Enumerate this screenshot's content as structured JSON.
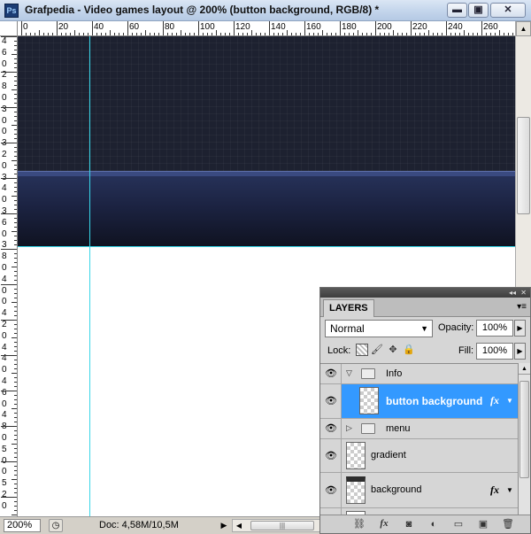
{
  "window": {
    "app_logo": "Ps",
    "title": "Grafpedia - Video games layout @ 200% (button background, RGB/8) *",
    "minimize_glyph": "▬",
    "maximize_glyph": "▣",
    "close_glyph": "✕"
  },
  "rulers": {
    "horizontal": [
      "0",
      "20",
      "40",
      "60",
      "80",
      "100",
      "120",
      "140",
      "160",
      "180",
      "200",
      "220",
      "240",
      "260"
    ],
    "vertical": [
      "4",
      "6",
      "0",
      "2",
      "8",
      "0",
      "3",
      "0",
      "0",
      "3",
      "2",
      "0",
      "3",
      "4",
      "0",
      "3",
      "6",
      "0",
      "3",
      "8",
      "0",
      "4",
      "0",
      "0",
      "4",
      "2",
      "0",
      "4",
      "4",
      "0",
      "4",
      "6",
      "0",
      "4",
      "8",
      "0",
      "5",
      "0",
      "0",
      "5",
      "2",
      "0"
    ]
  },
  "canvas": {
    "colors": {
      "pattern": "#1d2130",
      "stripe": "#3a4a80",
      "gradient_top": "#263158",
      "gradient_bottom": "#0f1220",
      "guide": "#38d6e8"
    }
  },
  "status": {
    "zoom": "200%",
    "doc_info": "Doc: 4,58M/10,5M",
    "arrow_glyph": "▶",
    "scroll_left_glyph": "◀",
    "scroll_grip": "|||"
  },
  "layers_panel": {
    "tab_label": "LAYERS",
    "collapse_glyph": "◂◂",
    "close_glyph": "✕",
    "menu_glyph": "▾≡",
    "blend_mode": "Normal",
    "blend_arrow": "▼",
    "opacity_label": "Opacity:",
    "opacity_value": "100%",
    "lock_label": "Lock:",
    "fill_label": "Fill:",
    "fill_value": "100%",
    "spin_glyph": "▶",
    "eye_glyph": "👁",
    "fx_label": "fx",
    "fx_arrow": "▼",
    "layers": [
      {
        "name": "Info",
        "kind": "group",
        "expanded": true,
        "disclosure": "▽"
      },
      {
        "name": "button background",
        "kind": "layer",
        "selected": true,
        "fx": true
      },
      {
        "name": "menu",
        "kind": "group",
        "expanded": false,
        "disclosure": "▷"
      },
      {
        "name": "gradient",
        "kind": "layer"
      },
      {
        "name": "background",
        "kind": "layer",
        "fx": true
      }
    ],
    "footer_icons": [
      "link-icon",
      "fx-icon",
      "mask-icon",
      "adjustment-icon",
      "new-group-icon",
      "new-layer-icon",
      "trash-icon"
    ],
    "footer_glyphs": [
      "⛓",
      "fx",
      "◙",
      "◐",
      "▭",
      "▣",
      "🗑"
    ]
  }
}
